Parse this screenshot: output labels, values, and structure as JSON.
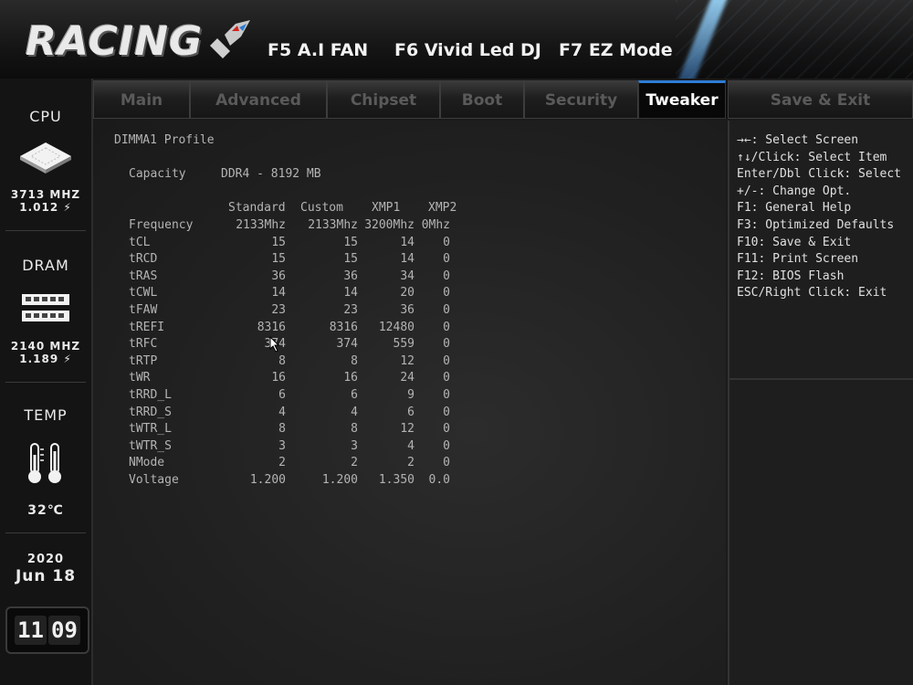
{
  "header": {
    "logo_text": "RACING",
    "hotkeys": [
      {
        "label": "F5 A.I FAN"
      },
      {
        "label": "F6 Vivid Led DJ"
      },
      {
        "label": "F7 EZ Mode"
      }
    ]
  },
  "sidebar": {
    "cpu": {
      "title": "CPU",
      "freq": "3713 MHZ",
      "volt": "1.012 ⚡"
    },
    "dram": {
      "title": "DRAM",
      "freq": "2140 MHZ",
      "volt": "1.189 ⚡"
    },
    "temp": {
      "title": "TEMP",
      "value": "32℃"
    },
    "date": {
      "year": "2020",
      "month_day": "Jun 18"
    },
    "clock": {
      "hours": "11",
      "minutes": "09"
    }
  },
  "tabs": [
    {
      "label": "Main",
      "active": false
    },
    {
      "label": "Advanced",
      "active": false
    },
    {
      "label": "Chipset",
      "active": false
    },
    {
      "label": "Boot",
      "active": false
    },
    {
      "label": "Security",
      "active": false
    },
    {
      "label": "Tweaker",
      "active": true
    },
    {
      "label": "Save & Exit",
      "active": false
    }
  ],
  "main": {
    "title": "DIMMA1 Profile",
    "capacity_label": "Capacity",
    "capacity_value": "DDR4 - 8192 MB",
    "columns": [
      "Standard",
      "Custom",
      "XMP1",
      "XMP2"
    ],
    "rows": [
      {
        "name": "Frequency",
        "values": [
          "2133Mhz",
          "2133Mhz",
          "3200Mhz",
          "0Mhz"
        ]
      },
      {
        "name": "tCL",
        "values": [
          "15",
          "15",
          "14",
          "0"
        ]
      },
      {
        "name": "tRCD",
        "values": [
          "15",
          "15",
          "14",
          "0"
        ]
      },
      {
        "name": "tRAS",
        "values": [
          "36",
          "36",
          "34",
          "0"
        ]
      },
      {
        "name": "tCWL",
        "values": [
          "14",
          "14",
          "20",
          "0"
        ]
      },
      {
        "name": "tFAW",
        "values": [
          "23",
          "23",
          "36",
          "0"
        ]
      },
      {
        "name": "tREFI",
        "values": [
          "8316",
          "8316",
          "12480",
          "0"
        ]
      },
      {
        "name": "tRFC",
        "values": [
          "374",
          "374",
          "559",
          "0"
        ]
      },
      {
        "name": "tRTP",
        "values": [
          "8",
          "8",
          "12",
          "0"
        ]
      },
      {
        "name": "tWR",
        "values": [
          "16",
          "16",
          "24",
          "0"
        ]
      },
      {
        "name": "tRRD_L",
        "values": [
          "6",
          "6",
          "9",
          "0"
        ]
      },
      {
        "name": "tRRD_S",
        "values": [
          "4",
          "4",
          "6",
          "0"
        ]
      },
      {
        "name": "tWTR_L",
        "values": [
          "8",
          "8",
          "12",
          "0"
        ]
      },
      {
        "name": "tWTR_S",
        "values": [
          "3",
          "3",
          "4",
          "0"
        ]
      },
      {
        "name": "NMode",
        "values": [
          "2",
          "2",
          "2",
          "0"
        ]
      },
      {
        "name": "Voltage",
        "values": [
          "1.200",
          "1.200",
          "1.350",
          "0.0"
        ]
      }
    ]
  },
  "help": {
    "lines": [
      "→←: Select Screen",
      "↑↓/Click: Select Item",
      "Enter/Dbl Click: Select",
      "+/-: Change Opt.",
      "F1: General Help",
      "F3: Optimized Defaults",
      "F10: Save & Exit",
      "F11: Print Screen",
      "F12: BIOS Flash",
      "ESC/Right Click: Exit"
    ]
  },
  "colors": {
    "accent": "#2e7cd6",
    "background": "#1b1b1b",
    "text": "#b4b4b4"
  }
}
